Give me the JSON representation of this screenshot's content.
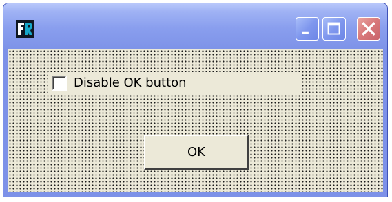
{
  "window": {
    "app_icon": "fr-app-icon",
    "controls": {
      "minimize_icon": "minimize-icon",
      "maximize_icon": "maximize-icon",
      "close_icon": "close-icon"
    }
  },
  "form": {
    "checkbox": {
      "label": "Disable OK button",
      "checked": false
    },
    "ok_button": {
      "label": "OK"
    }
  },
  "colors": {
    "titlebar": "#899eee",
    "client_bg": "#ece9d8",
    "close_button": "#d8787a"
  }
}
